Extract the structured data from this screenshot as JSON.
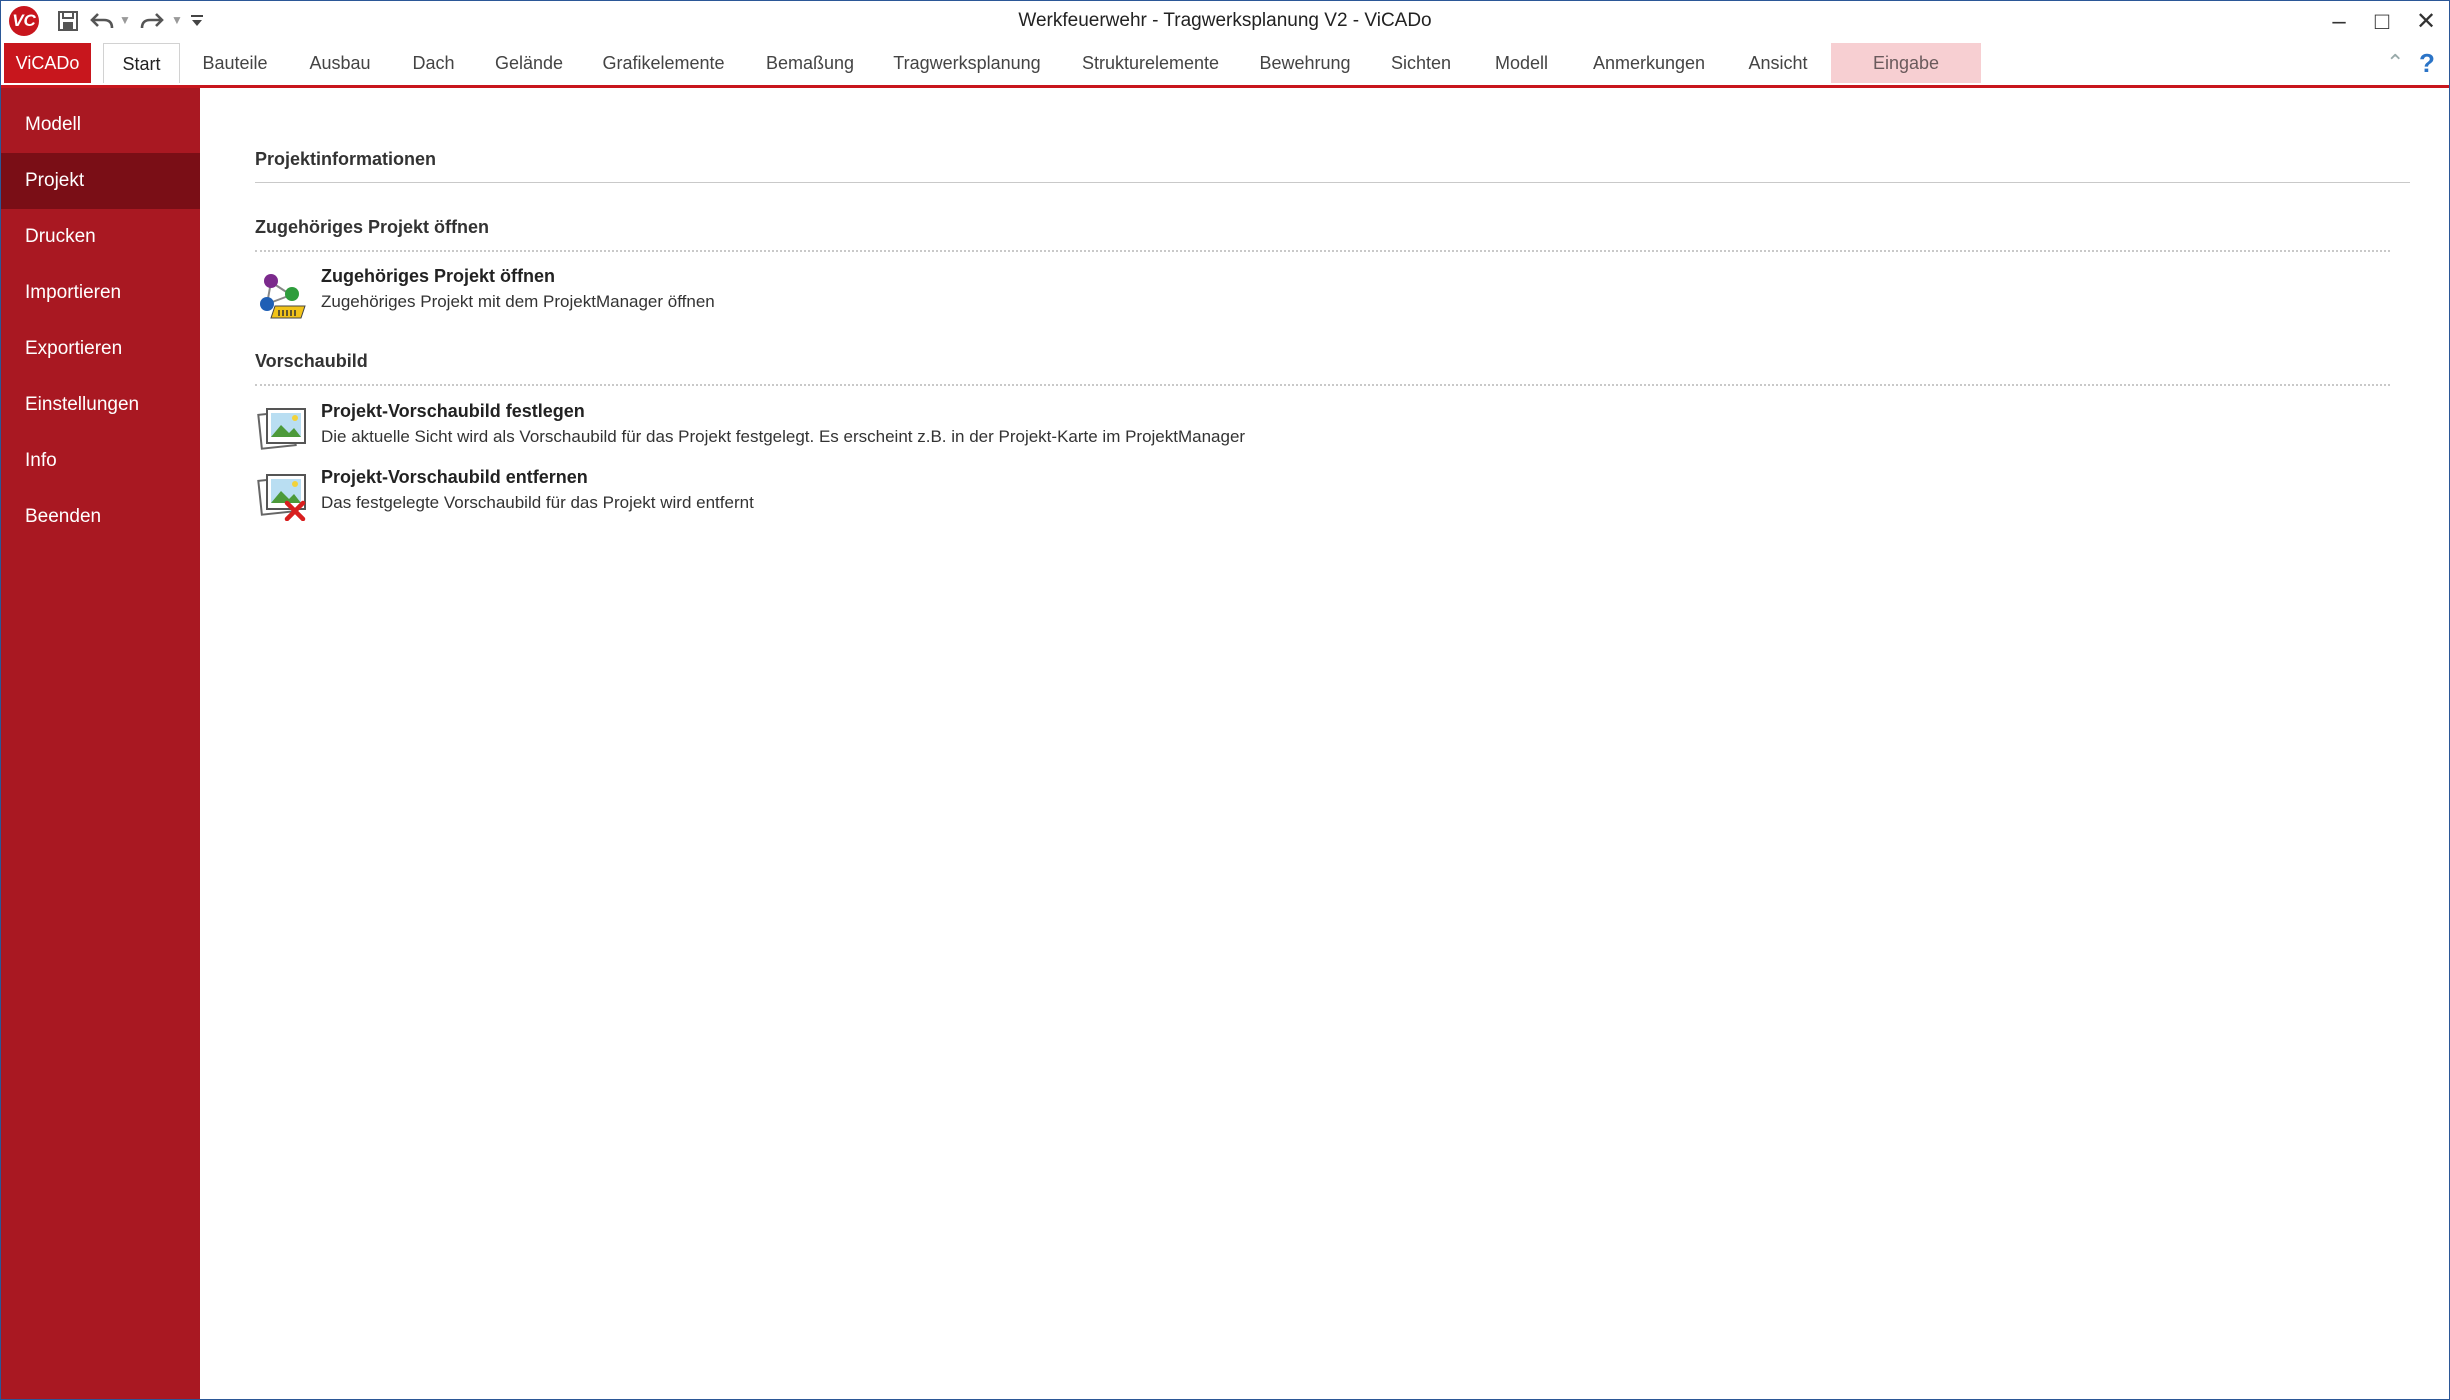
{
  "window": {
    "title": "Werkfeuerwehr - Tragwerksplanung V2 - ViCADo",
    "logo_text": "VC",
    "controls": {
      "minimize": "–",
      "maximize": "□",
      "close": "✕"
    }
  },
  "ribbon": {
    "file_tab": "ViCADo",
    "tabs": [
      {
        "label": "Start"
      },
      {
        "label": "Bauteile"
      },
      {
        "label": "Ausbau"
      },
      {
        "label": "Dach"
      },
      {
        "label": "Gelände"
      },
      {
        "label": "Grafikelemente"
      },
      {
        "label": "Bemaßung"
      },
      {
        "label": "Tragwerksplanung"
      },
      {
        "label": "Strukturelemente"
      },
      {
        "label": "Bewehrung"
      },
      {
        "label": "Sichten"
      },
      {
        "label": "Modell"
      },
      {
        "label": "Anmerkungen"
      },
      {
        "label": "Ansicht"
      },
      {
        "label": "Eingabe"
      }
    ],
    "active_tab": "Start",
    "context_tab": "Eingabe"
  },
  "sidebar": {
    "items": [
      {
        "label": "Modell"
      },
      {
        "label": "Projekt"
      },
      {
        "label": "Drucken"
      },
      {
        "label": "Importieren"
      },
      {
        "label": "Exportieren"
      },
      {
        "label": "Einstellungen"
      },
      {
        "label": "Info"
      },
      {
        "label": "Beenden"
      }
    ],
    "selected": "Projekt"
  },
  "content": {
    "heading": "Projektinformationen",
    "sections": [
      {
        "title": "Zugehöriges Projekt öffnen",
        "commands": [
          {
            "title": "Zugehöriges Projekt öffnen",
            "description": "Zugehöriges Projekt mit dem ProjektManager öffnen",
            "icon": "project-manager-icon"
          }
        ]
      },
      {
        "title": "Vorschaubild",
        "commands": [
          {
            "title": "Projekt-Vorschaubild festlegen",
            "description": "Die aktuelle Sicht wird als Vorschaubild für das Projekt festgelegt. Es erscheint z.B. in der Projekt-Karte im ProjektManager",
            "icon": "preview-image-icon"
          },
          {
            "title": "Projekt-Vorschaubild entfernen",
            "description": "Das festgelegte Vorschaubild für das Projekt wird entfernt",
            "icon": "remove-preview-image-icon"
          }
        ]
      }
    ]
  },
  "colors": {
    "accent": "#c8161d",
    "sidebar": "#a91822",
    "sidebar_selected": "#7a0e16",
    "context_tab": "#f7cfd2"
  }
}
